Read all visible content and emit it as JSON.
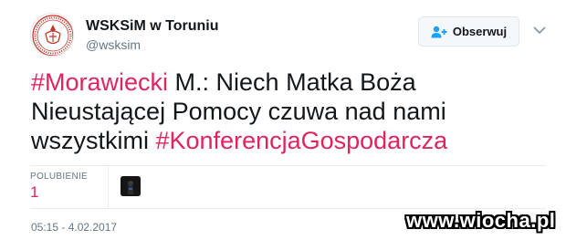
{
  "profile": {
    "display_name": "WSKSiM w Toruniu",
    "handle": "@wsksim"
  },
  "follow_button": {
    "label": "Obserwuj"
  },
  "tweet": {
    "segments": [
      {
        "text": "#Morawiecki",
        "type": "hashtag"
      },
      {
        "text": " M.: Niech Matka Boża Nieustającej Pomocy czuwa nad nami wszystkimi ",
        "type": "text"
      },
      {
        "text": "#KonferencjaGospodarcza",
        "type": "hashtag"
      }
    ]
  },
  "stats": {
    "likes_label": "POLUBIENIE",
    "likes_count": "1"
  },
  "timestamp": "05:15 - 4.02.2017",
  "watermark": "www.wiocha.pl",
  "colors": {
    "hashtag": "#e0245e",
    "text": "#14171a",
    "muted": "#657786",
    "border": "#e6ecf0"
  },
  "icons": {
    "follow": "person-plus-icon",
    "menu": "chevron-down-icon"
  }
}
